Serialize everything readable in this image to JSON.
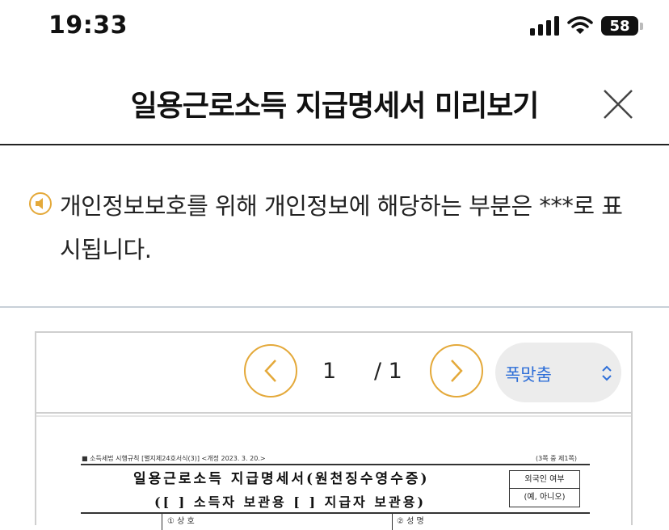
{
  "status_bar": {
    "time": "19:33",
    "battery": "58"
  },
  "header": {
    "title": "일용근로소득 지급명세서 미리보기"
  },
  "notice": {
    "text": "개인정보보호를 위해 개인정보에 해당하는 부분은 ***로 표시됩니다."
  },
  "viewer": {
    "page_current": "1",
    "page_total": "/ 1",
    "zoom_label": "폭맞춤"
  },
  "document": {
    "ref": "■ 소득세법 시행규칙 [별지제24호서식(3)] <개정 2023. 3. 20.>",
    "pages": "(3쪽 중 제1쪽)",
    "title_line1": "일용근로소득 지급명세서(원천징수영수증)",
    "title_line2": "([ ] 소득자 보관용 [ ] 지급자 보관용)",
    "foreign_label": "외국인 여부",
    "foreign_options": "(예, 아니오)",
    "field_company": "① 상 호",
    "field_name": "② 성 명"
  },
  "colors": {
    "accent": "#e4a93a",
    "link": "#2f6fd8",
    "divider": "#c8d0d8"
  }
}
